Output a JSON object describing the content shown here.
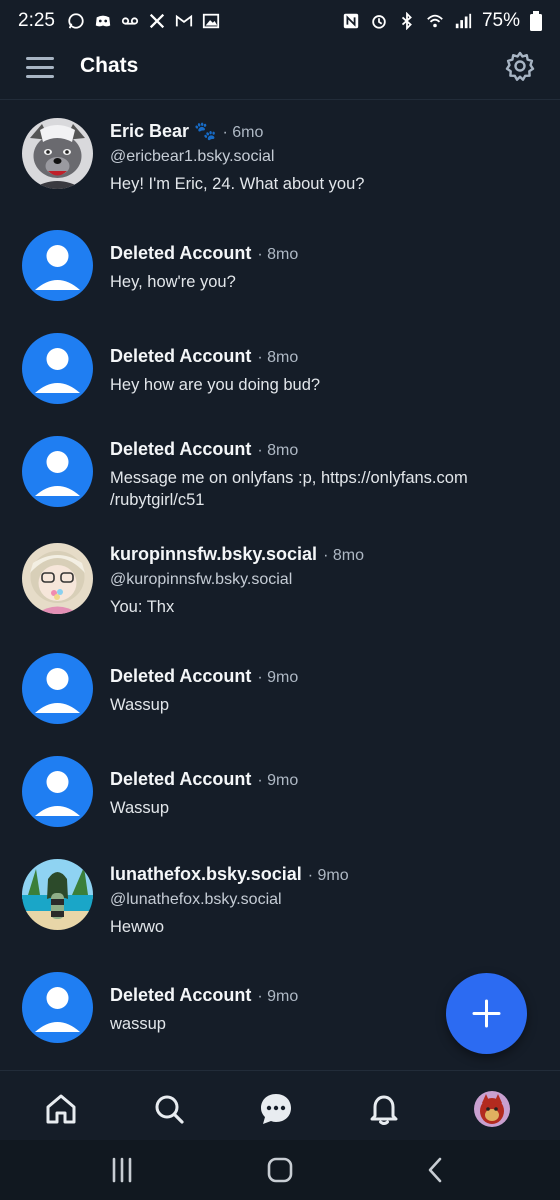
{
  "status_bar": {
    "time": "2:25",
    "battery": "75%"
  },
  "header": {
    "title": "Chats"
  },
  "chats": [
    {
      "name": "Eric Bear 🐾",
      "time": "· 6mo",
      "handle": "@ericbear1.bsky.social",
      "message": "Hey! I'm Eric, 24. What about you?"
    },
    {
      "name": "Deleted Account",
      "time": "· 8mo",
      "message": "Hey, how're you?"
    },
    {
      "name": "Deleted Account",
      "time": "· 8mo",
      "message": "Hey how are you doing bud?"
    },
    {
      "name": "Deleted Account",
      "time": "· 8mo",
      "message": "Message me on onlyfans :p, https://onlyfans.com /rubytgirl/c51"
    },
    {
      "name": "kuropinnsfw.bsky.social",
      "time": "· 8mo",
      "handle": "@kuropinnsfw.bsky.social",
      "message": "You: Thx"
    },
    {
      "name": "Deleted Account",
      "time": "· 9mo",
      "message": "Wassup"
    },
    {
      "name": "Deleted Account",
      "time": "· 9mo",
      "message": "Wassup"
    },
    {
      "name": "lunathefox.bsky.social",
      "time": "· 9mo",
      "handle": "@lunathefox.bsky.social",
      "message": "Hewwo"
    },
    {
      "name": "Deleted Account",
      "time": "· 9mo",
      "message": "wassup"
    }
  ],
  "colors": {
    "background": "#151d28",
    "accent": "#2c6bf2",
    "default_avatar": "#1f7ef2"
  },
  "bottom_nav": [
    "home-icon",
    "search-icon",
    "chat-icon",
    "bell-icon",
    "profile-avatar"
  ]
}
